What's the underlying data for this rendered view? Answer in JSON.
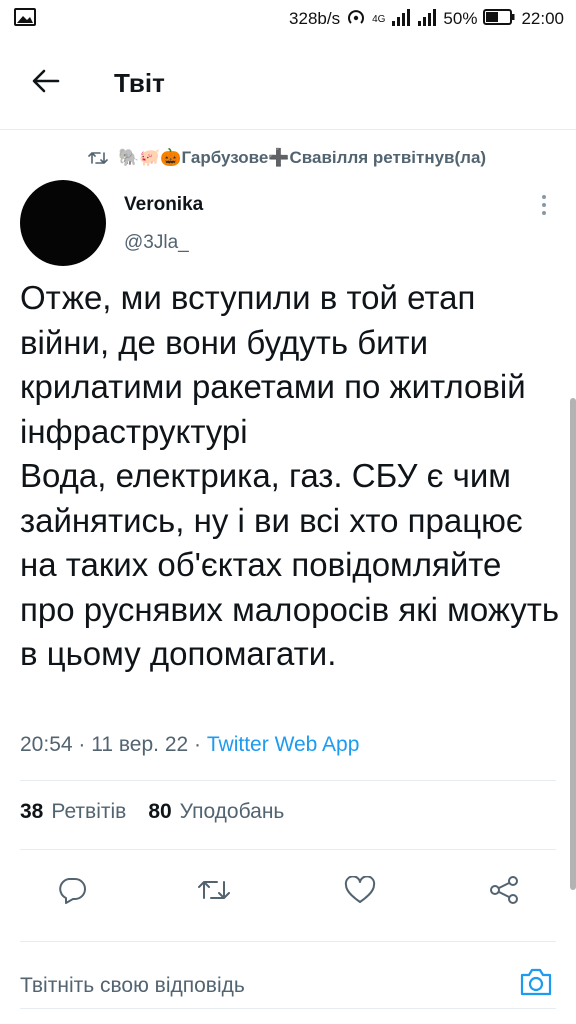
{
  "status_bar": {
    "speed": "328b/s",
    "network": "4G",
    "battery": "50%",
    "time": "22:00",
    "icons": [
      "image-icon",
      "hotspot-icon",
      "signal-icon",
      "signal-icon",
      "battery-icon"
    ]
  },
  "header": {
    "title": "Твіт",
    "back_icon": "arrow-left-icon"
  },
  "retweet_context": {
    "text": "🐘🐖🎃Гарбузове➕Свавілля ретвітнув(ла)",
    "icon": "retweet-icon"
  },
  "author": {
    "name": "Veronika",
    "handle": "@3Jla_"
  },
  "tweet": {
    "text": "Отже, ми вступили в той етап війни, де вони будуть бити крилатими ракетами по житловій інфраструктурі\nВода, електрика, газ. СБУ є чим зайнятись, ну і ви всі хто працює на таких об'єктах повідомляйте про руснявих малоросів які можуть в цьому допомагати.",
    "time": "20:54",
    "date": "11 вер. 22",
    "separator": "·",
    "source": "Twitter Web App"
  },
  "stats": {
    "retweets_count": "38",
    "retweets_label": "Ретвітів",
    "likes_count": "80",
    "likes_label": "Уподобань"
  },
  "actions": [
    "reply-icon",
    "retweet-icon",
    "heart-icon",
    "share-icon"
  ],
  "reply": {
    "placeholder": "Твітніть свою відповідь",
    "camera_icon": "camera-icon"
  },
  "colors": {
    "accent": "#1d9bf0",
    "secondary_text": "#536471",
    "primary_text": "#0f1419",
    "divider": "#e6ecf0"
  }
}
